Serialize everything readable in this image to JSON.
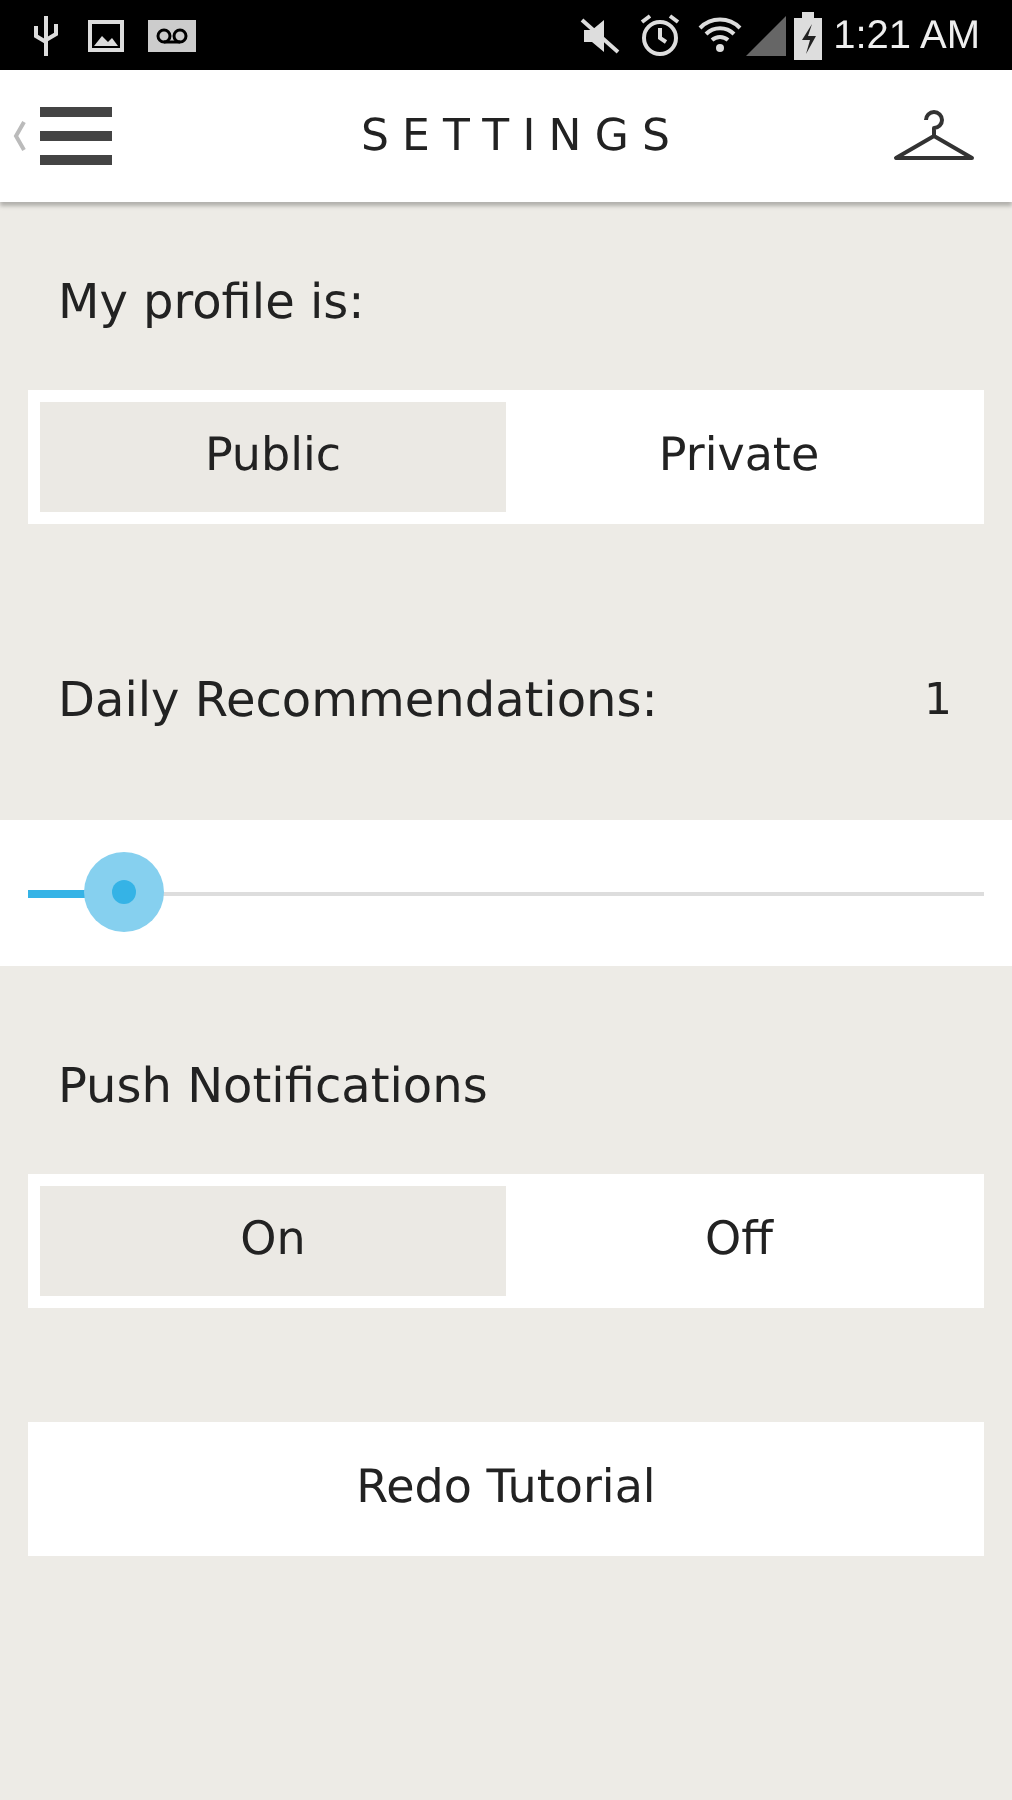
{
  "status_bar": {
    "time": "1:21 AM"
  },
  "header": {
    "title": "SETTINGS"
  },
  "profile": {
    "label": "My profile is:",
    "options": [
      {
        "label": "Public",
        "selected": true
      },
      {
        "label": "Private",
        "selected": false
      }
    ]
  },
  "recommendations": {
    "label": "Daily Recommendations:",
    "value": "1",
    "level": 0.1
  },
  "push": {
    "label": "Push Notifications",
    "options": [
      {
        "label": "On",
        "selected": true
      },
      {
        "label": "Off",
        "selected": false
      }
    ]
  },
  "tutorial_button": "Redo Tutorial"
}
